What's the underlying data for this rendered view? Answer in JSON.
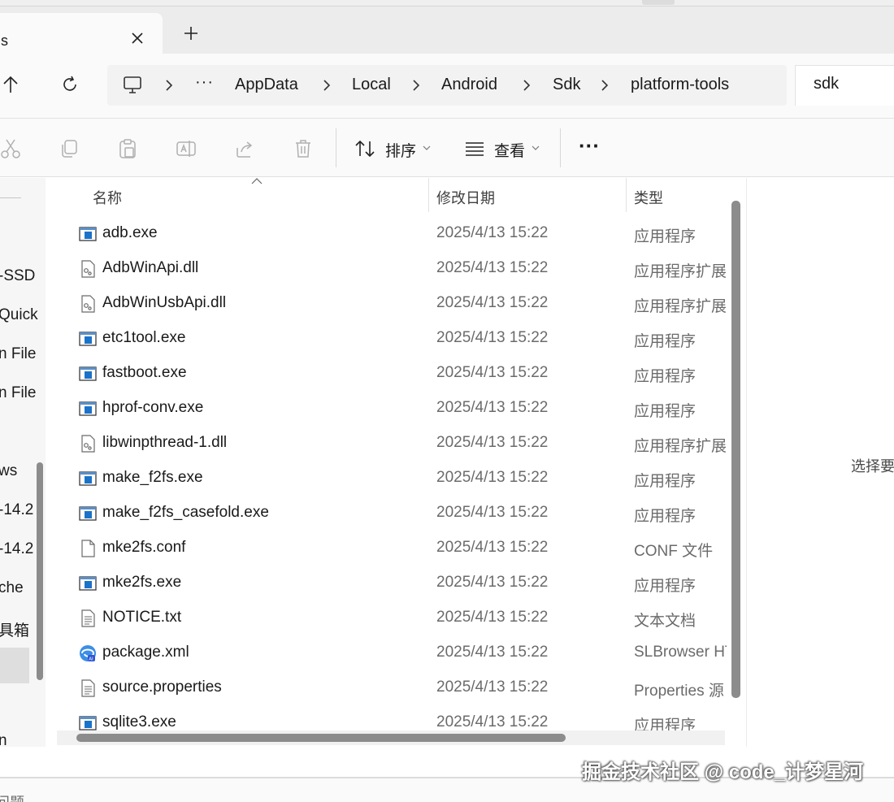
{
  "window": {
    "tab_title": "ls",
    "new_tab_glyph": "+"
  },
  "address": {
    "overflow_glyph": "···",
    "crumbs": [
      "AppData",
      "Local",
      "Android",
      "Sdk",
      "platform-tools"
    ],
    "search_value": "sdk"
  },
  "toolbar": {
    "sort_label": "排序",
    "view_label": "查看",
    "more_glyph": "···"
  },
  "nav": {
    "items": [
      "-SSD",
      "Quick",
      "n File",
      "n File",
      "ws",
      "-14.2",
      "-14.2",
      "che",
      "具箱",
      "n"
    ]
  },
  "columns": {
    "name": "名称",
    "date": "修改日期",
    "type": "类型"
  },
  "files": [
    {
      "name": "adb.exe",
      "date": "2025/4/13 15:22",
      "type": "应用程序",
      "icon": "exe"
    },
    {
      "name": "AdbWinApi.dll",
      "date": "2025/4/13 15:22",
      "type": "应用程序扩展",
      "icon": "dll"
    },
    {
      "name": "AdbWinUsbApi.dll",
      "date": "2025/4/13 15:22",
      "type": "应用程序扩展",
      "icon": "dll"
    },
    {
      "name": "etc1tool.exe",
      "date": "2025/4/13 15:22",
      "type": "应用程序",
      "icon": "exe"
    },
    {
      "name": "fastboot.exe",
      "date": "2025/4/13 15:22",
      "type": "应用程序",
      "icon": "exe"
    },
    {
      "name": "hprof-conv.exe",
      "date": "2025/4/13 15:22",
      "type": "应用程序",
      "icon": "exe"
    },
    {
      "name": "libwinpthread-1.dll",
      "date": "2025/4/13 15:22",
      "type": "应用程序扩展",
      "icon": "dll"
    },
    {
      "name": "make_f2fs.exe",
      "date": "2025/4/13 15:22",
      "type": "应用程序",
      "icon": "exe"
    },
    {
      "name": "make_f2fs_casefold.exe",
      "date": "2025/4/13 15:22",
      "type": "应用程序",
      "icon": "exe"
    },
    {
      "name": "mke2fs.conf",
      "date": "2025/4/13 15:22",
      "type": "CONF 文件",
      "icon": "blank"
    },
    {
      "name": "mke2fs.exe",
      "date": "2025/4/13 15:22",
      "type": "应用程序",
      "icon": "exe"
    },
    {
      "name": "NOTICE.txt",
      "date": "2025/4/13 15:22",
      "type": "文本文档",
      "icon": "txt"
    },
    {
      "name": "package.xml",
      "date": "2025/4/13 15:22",
      "type": "SLBrowser HT",
      "icon": "browser"
    },
    {
      "name": "source.properties",
      "date": "2025/4/13 15:22",
      "type": "Properties 源",
      "icon": "txt"
    },
    {
      "name": "sqlite3.exe",
      "date": "2025/4/13 15:22",
      "type": "应用程序",
      "icon": "exe"
    }
  ],
  "details": {
    "hint": "选择要"
  },
  "bottom": {
    "text": "问题"
  },
  "watermark": "掘金技术社区 @ code_计梦星河",
  "colors": {
    "accent_blue": "#1a73c9",
    "scrollbar": "#8c8c8c",
    "muted_text": "#6b6b6b"
  }
}
